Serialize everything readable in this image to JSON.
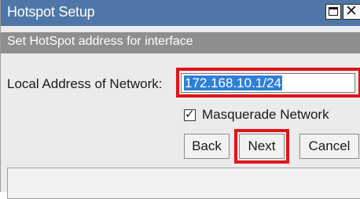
{
  "window": {
    "title": "Hotspot Setup",
    "subheader": "Set HotSpot address for interface",
    "maximize_icon": "maximize-icon",
    "close_icon": "close-icon",
    "close_glyph": "✕"
  },
  "form": {
    "address_label": "Local Address of Network:",
    "address_value": "172.168.10.1/24",
    "masquerade_label": "Masquerade Network",
    "masquerade_checked": true,
    "check_glyph": "✓"
  },
  "buttons": {
    "back_label": "Back",
    "next_label": "Next",
    "cancel_label": "Cancel"
  },
  "colors": {
    "titlebar": "#4e76a6",
    "subheader": "#8e8e8e",
    "highlight": "#e0141a",
    "selection": "#2e7fd6"
  }
}
